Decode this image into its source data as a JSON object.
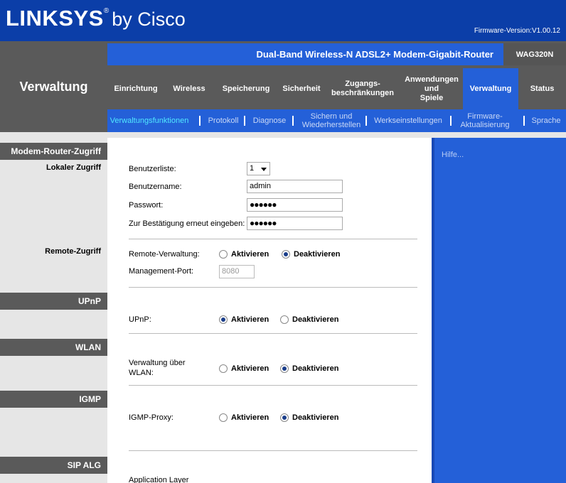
{
  "header": {
    "logo_main": "LINKSYS",
    "logo_reg": "®",
    "logo_by": "by Cisco",
    "firmware": "Firmware-Version:V1.00.12"
  },
  "section_title": "Verwaltung",
  "product_name": "Dual-Band Wireless-N ADSL2+ Modem-Gigabit-Router",
  "model": "WAG320N",
  "tabs": [
    {
      "label": "Einrichtung"
    },
    {
      "label": "Wireless"
    },
    {
      "label": "Speicherung"
    },
    {
      "label": "Sicherheit"
    },
    {
      "label": "Zugangs-\nbeschränkungen"
    },
    {
      "label": "Anwendungen\nund\nSpiele"
    },
    {
      "label": "Verwaltung"
    },
    {
      "label": "Status"
    }
  ],
  "subtabs": [
    {
      "label": "Verwaltungsfunktionen"
    },
    {
      "label": "Protokoll"
    },
    {
      "label": "Diagnose"
    },
    {
      "label": "Sichern und\nWiederherstellen"
    },
    {
      "label": "Werkseinstellungen"
    },
    {
      "label": "Firmware-\nAktualisierung"
    },
    {
      "label": "Sprache"
    }
  ],
  "left": {
    "modem_router": "Modem-Router-Zugriff",
    "local": "Lokaler Zugriff",
    "remote": "Remote-Zugriff",
    "upnp": "UPnP",
    "wlan": "WLAN",
    "igmp": "IGMP",
    "sipalg": "SIP ALG"
  },
  "form": {
    "userlist_label": "Benutzerliste:",
    "userlist_value": "1",
    "username_label": "Benutzername:",
    "username_value": "admin",
    "password_label": "Passwort:",
    "password_value": "●●●●●●",
    "confirm_label": "Zur Bestätigung erneut eingeben:",
    "confirm_value": "●●●●●●",
    "remote_label": "Remote-Verwaltung:",
    "port_label": "Management-Port:",
    "port_value": "8080",
    "upnp_label": "UPnP:",
    "wlan_label_1": "Verwaltung über",
    "wlan_label_2": "WLAN:",
    "igmp_label": "IGMP-Proxy:",
    "alg_label": "Application Layer",
    "enable": "Aktivieren",
    "disable": "Deaktivieren"
  },
  "help": "Hilfe..."
}
